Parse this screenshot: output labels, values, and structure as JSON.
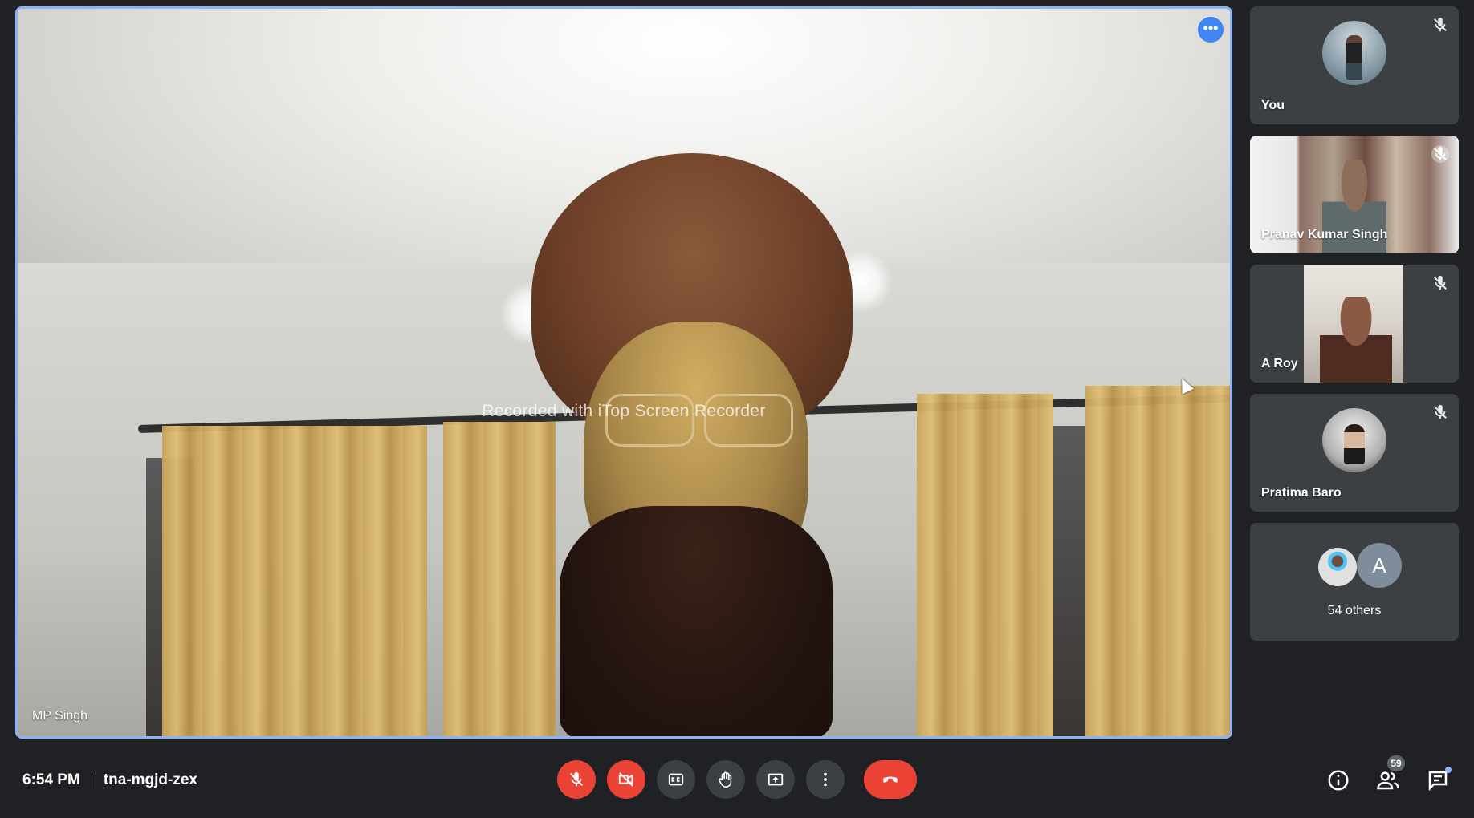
{
  "main_speaker": {
    "name": "MP Singh",
    "watermark": "Recorded with iTop Screen Recorder",
    "more_label": "•••"
  },
  "participants": [
    {
      "name": "You",
      "muted": true,
      "avatar": "you-avatar-icon"
    },
    {
      "name": "Pranav Kumar Singh",
      "muted": true,
      "avatar": "video"
    },
    {
      "name": "A Roy",
      "muted": true,
      "avatar": "video"
    },
    {
      "name": "Pratima Baro",
      "muted": true,
      "avatar": "pratima-avatar-icon"
    }
  ],
  "others": {
    "label": "54 others",
    "avatar_letter": "A"
  },
  "meeting": {
    "time": "6:54 PM",
    "code": "tna-mgjd-zex"
  },
  "controls": [
    {
      "name": "mic-off-button",
      "icon": "mic-off-icon",
      "active_alert": true
    },
    {
      "name": "camera-off-button",
      "icon": "camera-off-icon",
      "active_alert": true
    },
    {
      "name": "captions-button",
      "icon": "captions-icon"
    },
    {
      "name": "raise-hand-button",
      "icon": "hand-icon"
    },
    {
      "name": "present-button",
      "icon": "present-icon"
    },
    {
      "name": "more-options-button",
      "icon": "more-vert-icon"
    },
    {
      "name": "leave-call-button",
      "icon": "call-end-icon"
    }
  ],
  "right_panel": {
    "people_count": "59"
  },
  "colors": {
    "background": "#202124",
    "tile": "#3c4043",
    "alert_red": "#ea4335",
    "active_border": "#8ab4f8",
    "accent_blue": "#4285f4"
  }
}
